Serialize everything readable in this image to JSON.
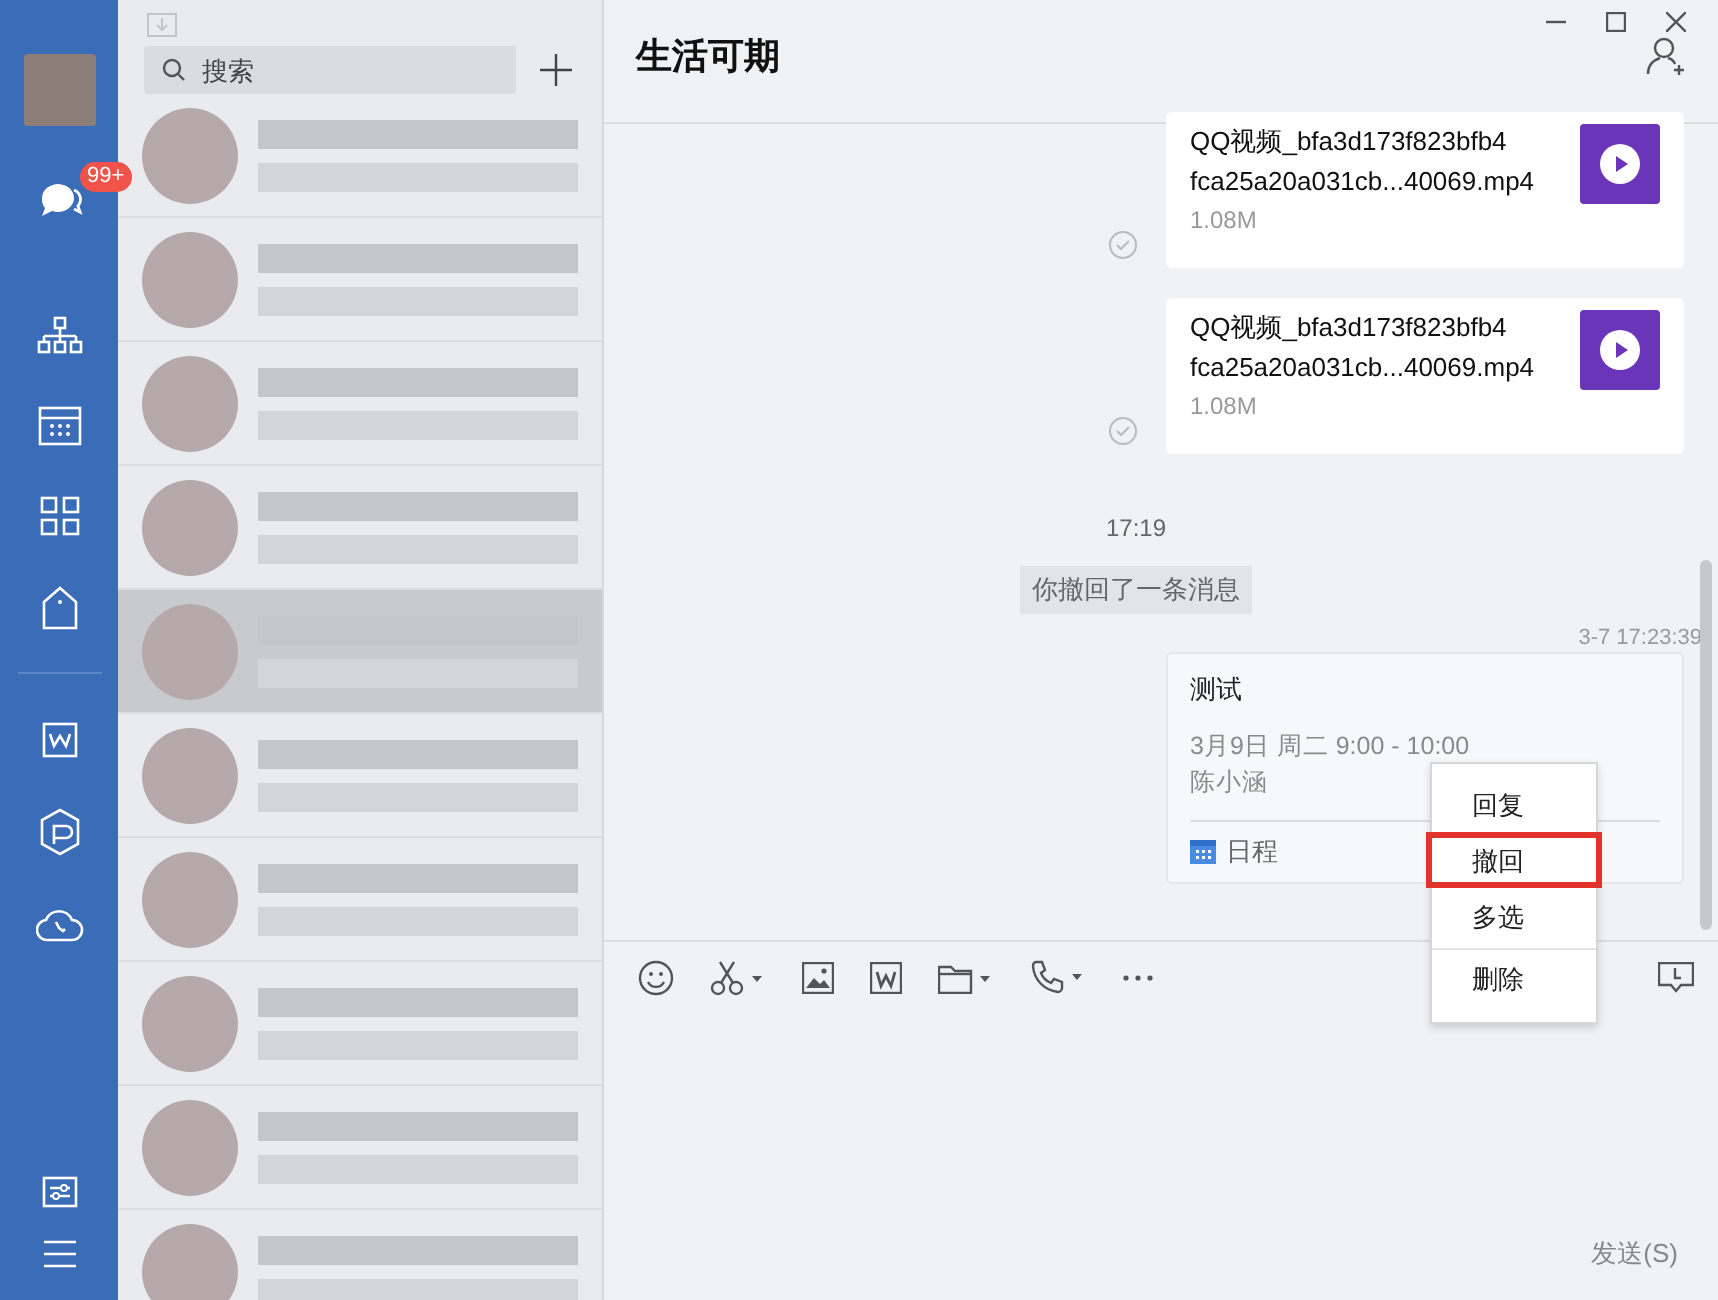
{
  "sidebar": {
    "badge": "99+"
  },
  "conversation_search": {
    "placeholder": "搜索"
  },
  "conversations": [
    {
      "selected": false
    },
    {
      "selected": false
    },
    {
      "selected": false
    },
    {
      "selected": false
    },
    {
      "selected": true
    },
    {
      "selected": false
    },
    {
      "selected": false
    },
    {
      "selected": false
    },
    {
      "selected": false
    },
    {
      "selected": false
    }
  ],
  "chat": {
    "title": "生活可期",
    "messages": [
      {
        "kind": "file",
        "name_lines": [
          "QQ视频_bfa3d173f823bfb4",
          "fca25a20a031cb...40069.mp4"
        ],
        "size": "1.08M",
        "read": true
      },
      {
        "kind": "file",
        "name_lines": [
          "QQ视频_bfa3d173f823bfb4",
          "fca25a20a031cb...40069.mp4"
        ],
        "size": "1.08M",
        "read": true
      },
      {
        "kind": "time",
        "text": "17:19"
      },
      {
        "kind": "system",
        "text": "你撤回了一条消息"
      },
      {
        "kind": "timestamp",
        "text": "3-7 17:23:39"
      },
      {
        "kind": "schedule",
        "title": "测试",
        "time": "3月9日 周二 9:00 - 10:00",
        "organizer": "陈小涵",
        "tag": "日程"
      }
    ],
    "send_button": "发送(S)"
  },
  "context_menu": [
    {
      "label": "回复",
      "highlighted": false,
      "separated": false
    },
    {
      "label": "撤回",
      "highlighted": true,
      "separated": false
    },
    {
      "label": "多选",
      "highlighted": false,
      "separated": false
    },
    {
      "label": "删除",
      "highlighted": false,
      "separated": true
    }
  ]
}
